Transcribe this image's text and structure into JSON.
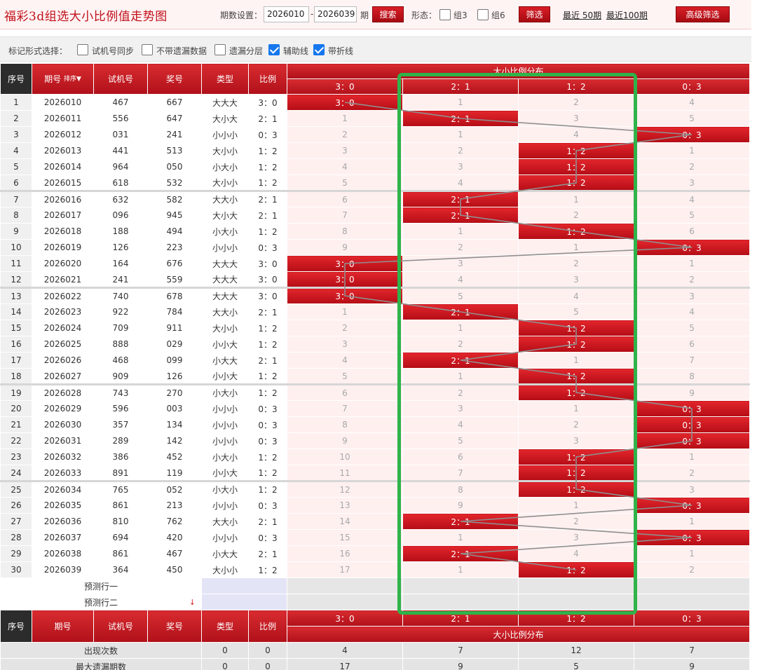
{
  "app": {
    "title": "福彩3d组选大小比例值走势图"
  },
  "toolbar": {
    "period_label": "期数设置：",
    "period_from": "2026010",
    "period_dash": "-",
    "period_to": "2026039",
    "period_unit": "期",
    "search_btn": "搜索",
    "form_label": "形态：",
    "group3": "组3",
    "group6": "组6",
    "filter_btn": "筛选",
    "recent50": "最近 50期",
    "recent100": "最近100期",
    "advanced_btn": "高级筛选"
  },
  "marks": {
    "label": "标记形式选择：",
    "options": [
      {
        "label": "试机号同步",
        "checked": false
      },
      {
        "label": "不带遗漏数据",
        "checked": false
      },
      {
        "label": "遗漏分层",
        "checked": false
      },
      {
        "label": "辅助线",
        "checked": true
      },
      {
        "label": "带折线",
        "checked": true
      }
    ]
  },
  "table": {
    "headers": {
      "idx": "序号",
      "issue": "期号",
      "issue_sort": "排序",
      "test": "试机号",
      "win": "奖号",
      "type": "类型",
      "ratio": "比例",
      "dist": "大小比例分布"
    },
    "ratio_cols": [
      "3：0",
      "2：1",
      "1：2",
      "0：3"
    ],
    "rows": [
      {
        "idx": "1",
        "issue": "2026010",
        "test": "467",
        "win": "667",
        "type": "大大大",
        "ratio": "3：0",
        "hit": 0,
        "miss": [
          "",
          "1",
          "2",
          "4"
        ]
      },
      {
        "idx": "2",
        "issue": "2026011",
        "test": "556",
        "win": "647",
        "type": "大小大",
        "ratio": "2：1",
        "hit": 1,
        "miss": [
          "1",
          "",
          "3",
          "5"
        ]
      },
      {
        "idx": "3",
        "issue": "2026012",
        "test": "031",
        "win": "241",
        "type": "小小小",
        "ratio": "0：3",
        "hit": 3,
        "miss": [
          "2",
          "1",
          "4",
          ""
        ]
      },
      {
        "idx": "4",
        "issue": "2026013",
        "test": "441",
        "win": "513",
        "type": "大小小",
        "ratio": "1：2",
        "hit": 2,
        "miss": [
          "3",
          "2",
          "",
          "1"
        ]
      },
      {
        "idx": "5",
        "issue": "2026014",
        "test": "964",
        "win": "050",
        "type": "小大小",
        "ratio": "1：2",
        "hit": 2,
        "miss": [
          "4",
          "3",
          "",
          "2"
        ]
      },
      {
        "idx": "6",
        "issue": "2026015",
        "test": "618",
        "win": "532",
        "type": "大小小",
        "ratio": "1：2",
        "hit": 2,
        "miss": [
          "5",
          "4",
          "",
          "3"
        ]
      },
      {
        "idx": "7",
        "issue": "2026016",
        "test": "632",
        "win": "582",
        "type": "大大小",
        "ratio": "2：1",
        "hit": 1,
        "miss": [
          "6",
          "",
          "1",
          "4"
        ]
      },
      {
        "idx": "8",
        "issue": "2026017",
        "test": "096",
        "win": "945",
        "type": "大小大",
        "ratio": "2：1",
        "hit": 1,
        "miss": [
          "7",
          "",
          "2",
          "5"
        ]
      },
      {
        "idx": "9",
        "issue": "2026018",
        "test": "188",
        "win": "494",
        "type": "小大小",
        "ratio": "1：2",
        "hit": 2,
        "miss": [
          "8",
          "1",
          "",
          "6"
        ]
      },
      {
        "idx": "10",
        "issue": "2026019",
        "test": "126",
        "win": "223",
        "type": "小小小",
        "ratio": "0：3",
        "hit": 3,
        "miss": [
          "9",
          "2",
          "1",
          ""
        ]
      },
      {
        "idx": "11",
        "issue": "2026020",
        "test": "164",
        "win": "676",
        "type": "大大大",
        "ratio": "3：0",
        "hit": 0,
        "miss": [
          "",
          "3",
          "2",
          "1"
        ]
      },
      {
        "idx": "12",
        "issue": "2026021",
        "test": "241",
        "win": "559",
        "type": "大大大",
        "ratio": "3：0",
        "hit": 0,
        "miss": [
          "",
          "4",
          "3",
          "2"
        ]
      },
      {
        "idx": "13",
        "issue": "2026022",
        "test": "740",
        "win": "678",
        "type": "大大大",
        "ratio": "3：0",
        "hit": 0,
        "miss": [
          "",
          "5",
          "4",
          "3"
        ]
      },
      {
        "idx": "14",
        "issue": "2026023",
        "test": "922",
        "win": "784",
        "type": "大大小",
        "ratio": "2：1",
        "hit": 1,
        "miss": [
          "1",
          "",
          "5",
          "4"
        ]
      },
      {
        "idx": "15",
        "issue": "2026024",
        "test": "709",
        "win": "911",
        "type": "大小小",
        "ratio": "1：2",
        "hit": 2,
        "miss": [
          "2",
          "1",
          "",
          "5"
        ]
      },
      {
        "idx": "16",
        "issue": "2026025",
        "test": "888",
        "win": "029",
        "type": "小小大",
        "ratio": "1：2",
        "hit": 2,
        "miss": [
          "3",
          "2",
          "",
          "6"
        ]
      },
      {
        "idx": "17",
        "issue": "2026026",
        "test": "468",
        "win": "099",
        "type": "小大大",
        "ratio": "2：1",
        "hit": 1,
        "miss": [
          "4",
          "",
          "1",
          "7"
        ]
      },
      {
        "idx": "18",
        "issue": "2026027",
        "test": "909",
        "win": "126",
        "type": "小小大",
        "ratio": "1：2",
        "hit": 2,
        "miss": [
          "5",
          "1",
          "",
          "8"
        ]
      },
      {
        "idx": "19",
        "issue": "2026028",
        "test": "743",
        "win": "270",
        "type": "小大小",
        "ratio": "1：2",
        "hit": 2,
        "miss": [
          "6",
          "2",
          "",
          "9"
        ]
      },
      {
        "idx": "20",
        "issue": "2026029",
        "test": "596",
        "win": "003",
        "type": "小小小",
        "ratio": "0：3",
        "hit": 3,
        "miss": [
          "7",
          "3",
          "1",
          ""
        ]
      },
      {
        "idx": "21",
        "issue": "2026030",
        "test": "357",
        "win": "134",
        "type": "小小小",
        "ratio": "0：3",
        "hit": 3,
        "miss": [
          "8",
          "4",
          "2",
          ""
        ]
      },
      {
        "idx": "22",
        "issue": "2026031",
        "test": "289",
        "win": "142",
        "type": "小小小",
        "ratio": "0：3",
        "hit": 3,
        "miss": [
          "9",
          "5",
          "3",
          ""
        ]
      },
      {
        "idx": "23",
        "issue": "2026032",
        "test": "386",
        "win": "452",
        "type": "小大小",
        "ratio": "1：2",
        "hit": 2,
        "miss": [
          "10",
          "6",
          "",
          "1"
        ]
      },
      {
        "idx": "24",
        "issue": "2026033",
        "test": "891",
        "win": "119",
        "type": "小小大",
        "ratio": "1：2",
        "hit": 2,
        "miss": [
          "11",
          "7",
          "",
          "2"
        ]
      },
      {
        "idx": "25",
        "issue": "2026034",
        "test": "765",
        "win": "052",
        "type": "小大小",
        "ratio": "1：2",
        "hit": 2,
        "miss": [
          "12",
          "8",
          "",
          "3"
        ]
      },
      {
        "idx": "26",
        "issue": "2026035",
        "test": "861",
        "win": "213",
        "type": "小小小",
        "ratio": "0：3",
        "hit": 3,
        "miss": [
          "13",
          "9",
          "1",
          ""
        ]
      },
      {
        "idx": "27",
        "issue": "2026036",
        "test": "810",
        "win": "762",
        "type": "大大小",
        "ratio": "2：1",
        "hit": 1,
        "miss": [
          "14",
          "",
          "2",
          "1"
        ]
      },
      {
        "idx": "28",
        "issue": "2026037",
        "test": "694",
        "win": "420",
        "type": "小小小",
        "ratio": "0：3",
        "hit": 3,
        "miss": [
          "15",
          "1",
          "3",
          ""
        ]
      },
      {
        "idx": "29",
        "issue": "2026038",
        "test": "861",
        "win": "467",
        "type": "小大大",
        "ratio": "2：1",
        "hit": 1,
        "miss": [
          "16",
          "",
          "4",
          "1"
        ]
      },
      {
        "idx": "30",
        "issue": "2026039",
        "test": "364",
        "win": "450",
        "type": "大小小",
        "ratio": "1：2",
        "hit": 2,
        "miss": [
          "17",
          "1",
          "",
          "2"
        ]
      }
    ],
    "predict1": "预测行一",
    "predict2": "预测行二",
    "stats": [
      {
        "label": "出现次数",
        "type": "0",
        "ratio": "0",
        "vals": [
          "4",
          "7",
          "12",
          "7"
        ]
      },
      {
        "label": "最大遗漏期数",
        "type": "0",
        "ratio": "0",
        "vals": [
          "17",
          "9",
          "5",
          "9"
        ]
      }
    ]
  },
  "colors": {
    "brand_red": "#c0101a",
    "hit_red": "#d01820",
    "highlight_green": "#2fb34a"
  }
}
